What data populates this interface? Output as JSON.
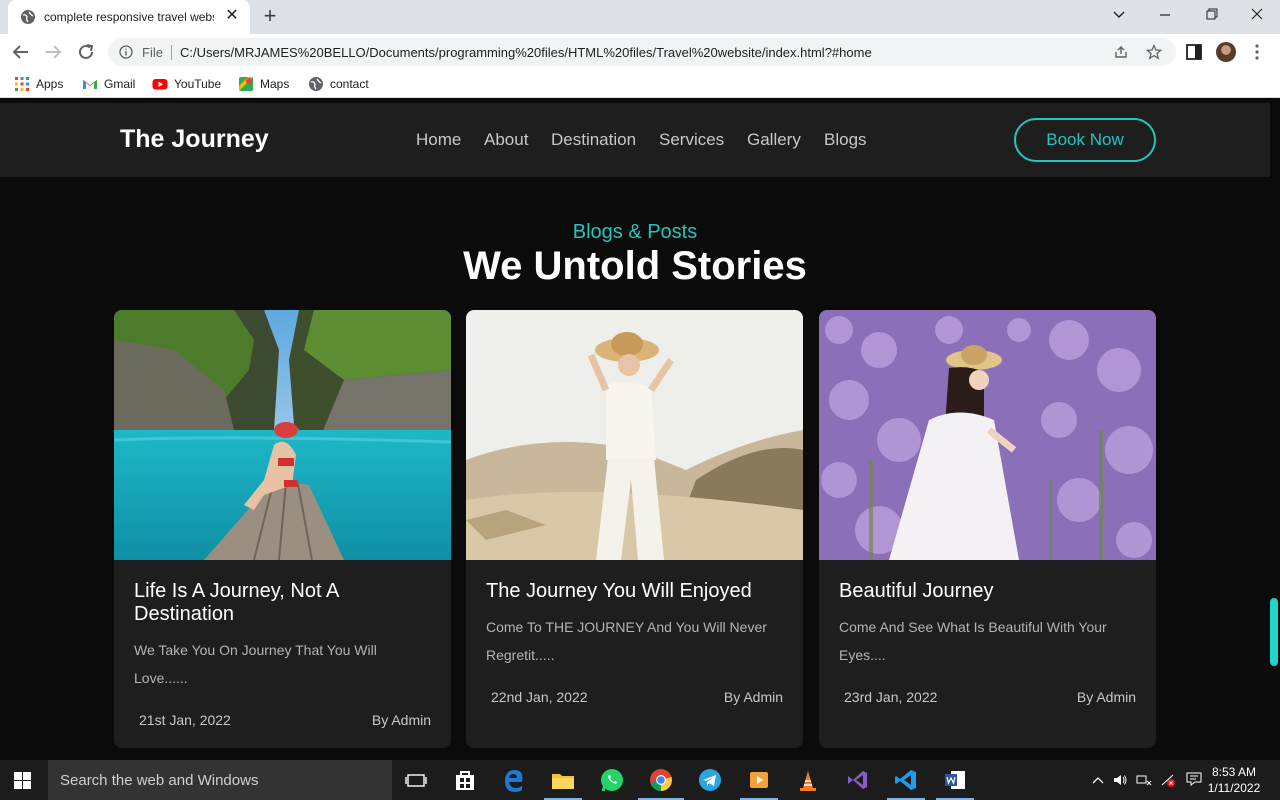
{
  "browser": {
    "tab_title": "complete responsive travel webs",
    "omnibox_scheme": "File",
    "url": "C:/Users/MRJAMES%20BELLO/Documents/programming%20files/HTML%20files/Travel%20website/index.html?#home",
    "bookmarks": [
      {
        "label": "Apps",
        "icon": "apps-grid-icon"
      },
      {
        "label": "Gmail",
        "icon": "gmail-icon"
      },
      {
        "label": "YouTube",
        "icon": "youtube-icon"
      },
      {
        "label": "Maps",
        "icon": "maps-icon"
      },
      {
        "label": "contact",
        "icon": "globe-icon"
      }
    ]
  },
  "site": {
    "logo": "The Journey",
    "nav": [
      "Home",
      "About",
      "Destination",
      "Services",
      "Gallery",
      "Blogs"
    ],
    "book_button": "Book Now",
    "accent": "#21c6bf"
  },
  "blog": {
    "subtitle": "Blogs & Posts",
    "title": "We Untold Stories",
    "posts": [
      {
        "title": "Life Is A Journey, Not A Destination",
        "description": "We Take You On Journey That You Will Love......",
        "date": "21st Jan, 2022",
        "author": "By Admin",
        "image": "woman-on-boat-tropical-lagoon"
      },
      {
        "title": "The Journey You Will Enjoyed",
        "description": "Come To THE JOURNEY And You Will Never Regretit.....",
        "date": "22nd Jan, 2022",
        "author": "By Admin",
        "image": "woman-in-white-desert-dunes"
      },
      {
        "title": "Beautiful Journey",
        "description": "Come And See What Is Beautiful With Your Eyes....",
        "date": "23rd Jan, 2022",
        "author": "By Admin",
        "image": "woman-in-lavender-flowers"
      }
    ]
  },
  "taskbar": {
    "search_placeholder": "Search the web and Windows",
    "time": "8:53 AM",
    "date": "1/11/2022"
  }
}
